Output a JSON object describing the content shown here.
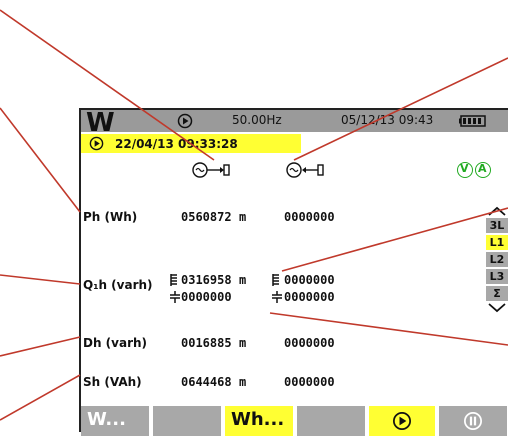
{
  "header": {
    "mode_icon": "watt-meter-logo",
    "mode_text": "W",
    "play_icon": "play-icon",
    "frequency": "50.00Hz",
    "datetime": "05/12/13 09:43",
    "battery_icon": "battery-icon"
  },
  "start_bar": {
    "icon": "play-icon",
    "datetime": "22/04/13 09:33:28"
  },
  "columns": {
    "consumed_icon": "energy-consumed-icon",
    "generated_icon": "energy-generated-icon",
    "v_indicator": "V",
    "a_indicator": "A"
  },
  "rows": [
    {
      "label": "Ph (Wh)",
      "consumed": "0560872",
      "consumed_unit": "m",
      "generated": "0000000"
    },
    {
      "label": "Q₁h (varh)",
      "consumed": "0316958",
      "consumed_unit": "m",
      "generated": "0000000",
      "inductive_icon": "inductive-icon",
      "capacitive_icon": "capacitive-icon",
      "consumed2": "0000000",
      "generated2": "0000000"
    },
    {
      "label": "Dh (varh)",
      "consumed": "0016885",
      "consumed_unit": "m",
      "generated": "0000000"
    },
    {
      "label": "Sh (VAh)",
      "consumed": "0644468",
      "consumed_unit": "m",
      "generated": "0000000"
    }
  ],
  "phase_tabs": [
    "3L",
    "L1",
    "L2",
    "L3",
    "Σ"
  ],
  "selected_tab": "L1",
  "function_keys": [
    "W...",
    "",
    "Wh...",
    "",
    "play",
    "pause"
  ],
  "colors": {
    "highlight": "#ffff33",
    "bar_gray": "#9a9a9a",
    "indicator_green": "#22aa22",
    "callout_line": "#c0392b"
  }
}
